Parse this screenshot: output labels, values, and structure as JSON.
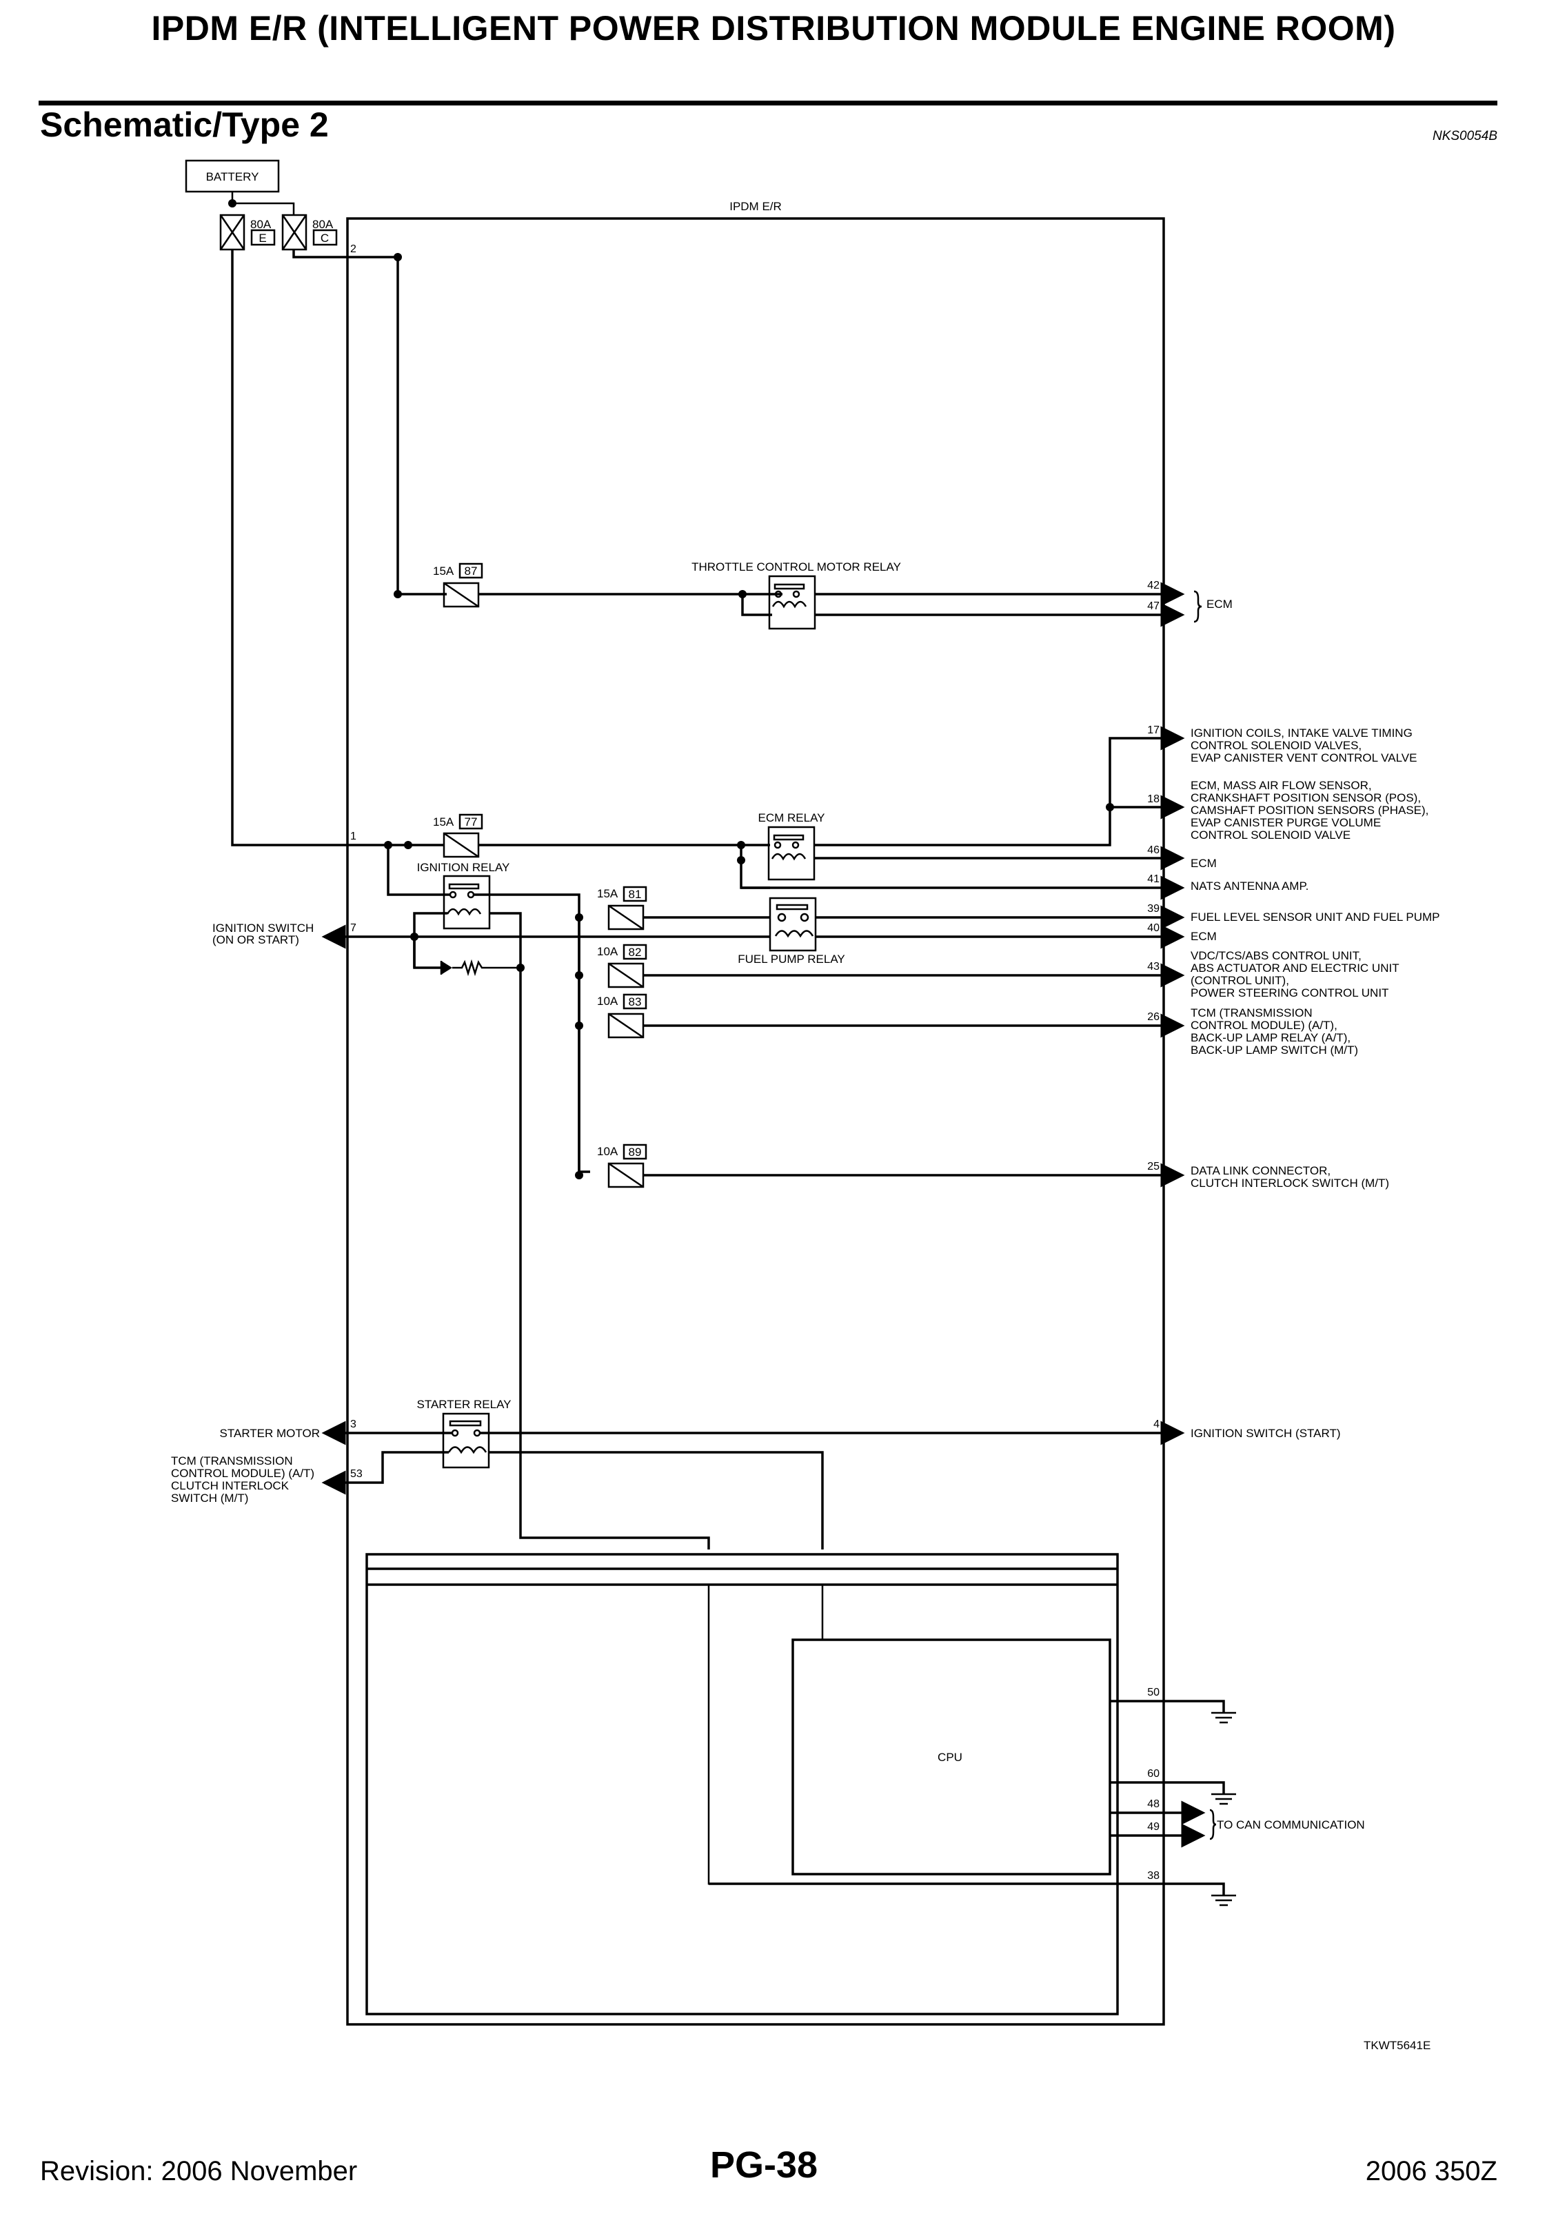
{
  "header": {
    "title": "IPDM E/R (INTELLIGENT POWER DISTRIBUTION MODULE ENGINE ROOM)",
    "subtitle": "Schematic/Type 2",
    "section_code": "NKS0054B"
  },
  "schematic": {
    "battery_label": "BATTERY",
    "module_label": "IPDM E/R",
    "cpu_label": "CPU",
    "figure_code": "TKWT5641E",
    "fusible_links": [
      {
        "rating": "80A",
        "id": "E"
      },
      {
        "rating": "80A",
        "id": "C"
      }
    ],
    "fuses": [
      {
        "rating": "15A",
        "id": "87"
      },
      {
        "rating": "15A",
        "id": "77"
      },
      {
        "rating": "15A",
        "id": "81"
      },
      {
        "rating": "10A",
        "id": "82"
      },
      {
        "rating": "10A",
        "id": "83"
      },
      {
        "rating": "10A",
        "id": "89"
      }
    ],
    "relays": {
      "throttle": "THROTTLE CONTROL MOTOR RELAY",
      "ecm": "ECM RELAY",
      "ignition": "IGNITION RELAY",
      "fuel_pump": "FUEL PUMP RELAY",
      "starter": "STARTER RELAY"
    },
    "left_pins": [
      {
        "pin": "2"
      },
      {
        "pin": "1"
      },
      {
        "pin": "7",
        "label": [
          "IGNITION SWITCH",
          "(ON OR START)"
        ]
      },
      {
        "pin": "3",
        "label": [
          "STARTER MOTOR"
        ]
      },
      {
        "pin": "53",
        "label": [
          "TCM (TRANSMISSION",
          "CONTROL MODULE) (A/T)",
          "CLUTCH INTERLOCK",
          "SWITCH (M/T)"
        ]
      }
    ],
    "right_pins": [
      {
        "pin": "42"
      },
      {
        "pin": "47"
      },
      {
        "pin": "17"
      },
      {
        "pin": "18"
      },
      {
        "pin": "46"
      },
      {
        "pin": "41"
      },
      {
        "pin": "39"
      },
      {
        "pin": "40"
      },
      {
        "pin": "43"
      },
      {
        "pin": "26"
      },
      {
        "pin": "25"
      },
      {
        "pin": "4"
      },
      {
        "pin": "50"
      },
      {
        "pin": "60"
      },
      {
        "pin": "48"
      },
      {
        "pin": "49"
      },
      {
        "pin": "38"
      }
    ],
    "destinations": {
      "ecm_group": [
        "ECM"
      ],
      "p17": [
        "IGNITION COILS, INTAKE VALVE TIMING",
        "CONTROL SOLENOID VALVES,",
        "EVAP CANISTER VENT CONTROL VALVE"
      ],
      "p18": [
        "ECM, MASS AIR FLOW SENSOR,",
        "CRANKSHAFT POSITION SENSOR (POS),",
        "CAMSHAFT POSITION SENSORS (PHASE),",
        "EVAP CANISTER PURGE VOLUME",
        "CONTROL SOLENOID VALVE"
      ],
      "p46": [
        "ECM"
      ],
      "p41": [
        "NATS ANTENNA AMP."
      ],
      "p39": [
        "FUEL LEVEL SENSOR UNIT AND FUEL PUMP"
      ],
      "p40": [
        "ECM"
      ],
      "p43": [
        "VDC/TCS/ABS CONTROL UNIT,",
        "ABS ACTUATOR AND ELECTRIC UNIT",
        "(CONTROL UNIT),",
        "POWER STEERING CONTROL UNIT"
      ],
      "p26": [
        "TCM (TRANSMISSION",
        "CONTROL MODULE) (A/T),",
        "BACK-UP LAMP RELAY (A/T),",
        "BACK-UP LAMP SWITCH (M/T)"
      ],
      "p25": [
        "DATA LINK CONNECTOR,",
        "CLUTCH INTERLOCK SWITCH (M/T)"
      ],
      "p4": [
        "IGNITION SWITCH (START)"
      ],
      "can": [
        "TO CAN COMMUNICATION"
      ]
    }
  },
  "footer": {
    "revision": "Revision: 2006 November",
    "page": "PG-38",
    "model": "2006 350Z"
  }
}
